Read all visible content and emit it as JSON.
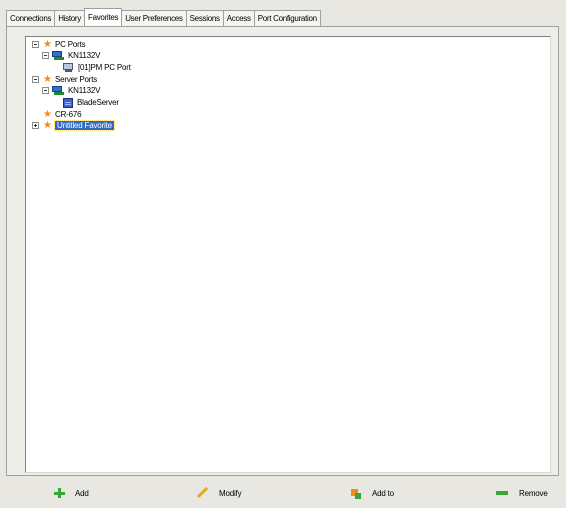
{
  "tabs": [
    {
      "label": "Connections",
      "active": false
    },
    {
      "label": "History",
      "active": false
    },
    {
      "label": "Favorites",
      "active": true
    },
    {
      "label": "User Preferences",
      "active": false
    },
    {
      "label": "Sessions",
      "active": false
    },
    {
      "label": "Access",
      "active": false
    },
    {
      "label": "Port Configuration",
      "active": false
    }
  ],
  "tree": {
    "pc_ports": {
      "label": "PC Ports",
      "icon": "star-icon",
      "expanded": true
    },
    "pc_kn1132v": {
      "label": "KN1132V",
      "icon": "kvm-switch-icon",
      "expanded": true
    },
    "pc_port_01": {
      "label": "[01]PM PC Port",
      "icon": "computer-icon"
    },
    "server_ports": {
      "label": "Server Ports",
      "icon": "star-icon",
      "expanded": true
    },
    "server_kn1132v": {
      "label": "KN1132V",
      "icon": "kvm-switch-icon",
      "expanded": true
    },
    "blade_server": {
      "label": "BladeServer",
      "icon": "server-icon"
    },
    "cr676": {
      "label": "CR-676",
      "icon": "star-icon"
    },
    "untitled": {
      "label": "Untitled Favorite",
      "icon": "star-icon",
      "expanded": false,
      "selected": true
    }
  },
  "buttons": {
    "add": "Add",
    "modify": "Modify",
    "addto": "Add to",
    "remove": "Remove"
  },
  "colors": {
    "selection": "#316ac5",
    "star": "#f08a1c",
    "green": "#3aa63a"
  }
}
